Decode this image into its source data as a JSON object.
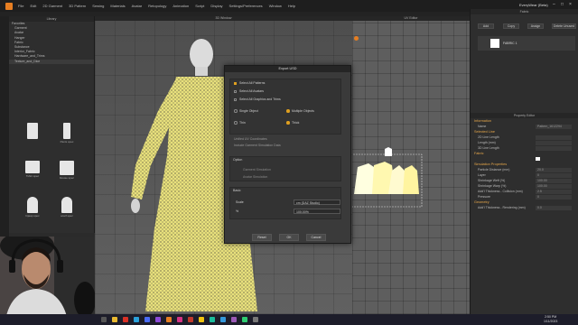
{
  "menubar": {
    "items": [
      "File",
      "Edit",
      "2D Garment",
      "3D Pattern",
      "Sewing",
      "Materials",
      "Avatar",
      "Retopology",
      "Animation",
      "Script",
      "Display",
      "Settings/Preferences",
      "Window",
      "Help"
    ],
    "app_title": "- - -",
    "user": "EveryWear (Beta)"
  },
  "library": {
    "title": "Library",
    "section": "Favorites",
    "tree": [
      "Garment",
      "Avatar",
      "Hanger",
      "Fabric",
      "Substance",
      "Interior_Fabric",
      "Hardware_and_Trims",
      "Texture_and_Dice"
    ],
    "thumbs": [
      {
        "label": ""
      },
      {
        "label": "Pants spec"
      },
      {
        "label": "Tshirt spec"
      },
      {
        "label": "blouse spec"
      },
      {
        "label": "hijaap spec"
      },
      {
        "label": "scarf spec"
      }
    ]
  },
  "view3d": {
    "title": "3D Window"
  },
  "view2d": {
    "title": "UV Editor"
  },
  "objbrowser": {
    "title": "Fabric",
    "buttons": [
      "Add",
      "Copy",
      "Assign",
      "Delete Unused"
    ],
    "item": "FABRIC 1"
  },
  "propeditor": {
    "title": "Property Editor",
    "sections": {
      "information": "Information",
      "selected_line": "Selected Line",
      "fabric": "Fabric",
      "simulation_props": "Simulation Properties",
      "geometry": "Geometry"
    },
    "rows": [
      {
        "label": "Name",
        "value": "Pattern_1612294"
      },
      {
        "label": "2D Line Length",
        "value": ""
      },
      {
        "label": "Length (mm)",
        "value": ""
      },
      {
        "label": "3D Line Length",
        "value": ""
      },
      {
        "label": "Particle Distance (mm)",
        "value": "20.0"
      },
      {
        "label": "Layer",
        "value": "0"
      },
      {
        "label": "Shrinkage Weft (%)",
        "value": "100.00"
      },
      {
        "label": "Shrinkage Warp (%)",
        "value": "100.00"
      },
      {
        "label": "Add'l Thickness - Collision (mm)",
        "value": "2.5"
      },
      {
        "label": "Pressure",
        "value": "0"
      },
      {
        "label": "Add'l Thickness - Rendering (mm)",
        "value": "0.0"
      }
    ]
  },
  "dialog": {
    "title": "Export USD",
    "checks": [
      {
        "label": "Select All Patterns",
        "on": true
      },
      {
        "label": "Select All Avatars",
        "on": false
      },
      {
        "label": "Select All Graphics and Trims",
        "on": false
      }
    ],
    "radios1": [
      {
        "label": "Single Object",
        "on": false
      },
      {
        "label": "Multiple Objects",
        "on": true
      }
    ],
    "radios2": [
      {
        "label": "Thin",
        "on": false
      },
      {
        "label": "Thick",
        "on": true
      }
    ],
    "opt1": "Unified UV Coordinates",
    "opt2": "Include Garment Simulation Data",
    "option_title": "Option",
    "option_items": [
      "Garment Simulation",
      "Avatar Simulation"
    ],
    "basic_title": "Basic",
    "scale_label": "Scale",
    "scale_value": "cm (DAZ Studio)",
    "percent_label": "%",
    "percent_value": "100.00%",
    "buttons": [
      "Reset",
      "OK",
      "Cancel"
    ]
  },
  "taskbar": {
    "time": "2:50 PM",
    "date": "1/11/2023"
  }
}
